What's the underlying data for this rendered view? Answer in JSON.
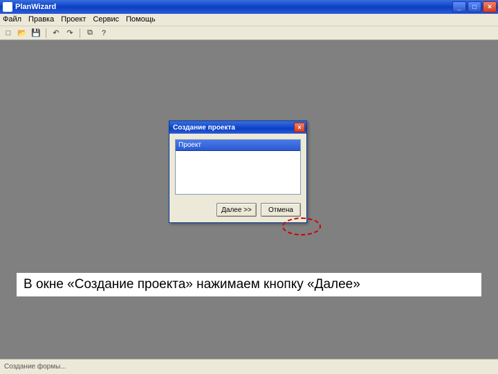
{
  "window": {
    "title": "PlanWizard",
    "controls": {
      "min": "_",
      "max": "□",
      "close": "×"
    }
  },
  "menu": {
    "file": "Файл",
    "edit": "Правка",
    "project": "Проект",
    "service": "Сервис",
    "help": "Помощь"
  },
  "toolbar": {
    "new": "□",
    "open": "📂",
    "save": "💾",
    "undo": "↶",
    "redo": "↷",
    "copy": "⧉",
    "help": "?"
  },
  "dialog": {
    "title": "Создание проекта",
    "close": "×",
    "column_header": "Проект",
    "next": "Далее >>",
    "cancel": "Отмена"
  },
  "status": {
    "text": "Создание формы..."
  },
  "caption": {
    "text": "В окне «Создание проекта» нажимаем кнопку «Далее»"
  }
}
